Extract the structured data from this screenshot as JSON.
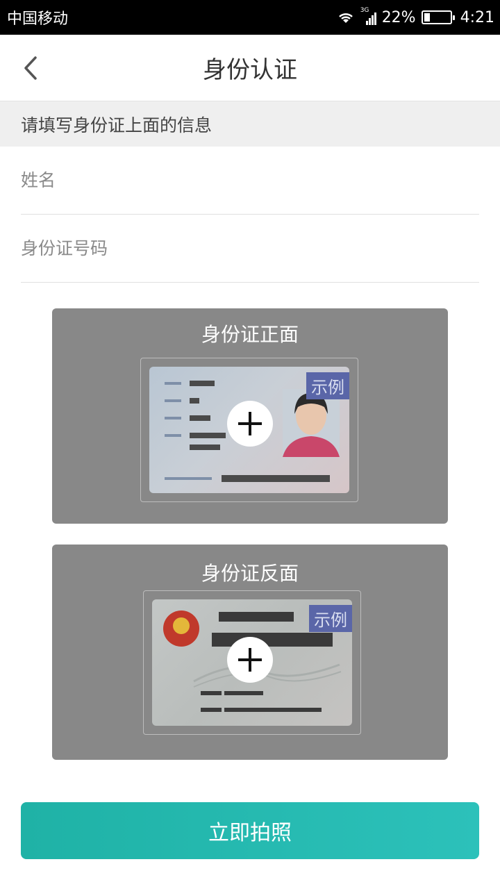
{
  "status_bar": {
    "carrier": "中国移动",
    "network": "3G",
    "battery_percent": "22%",
    "battery_level": 0.22,
    "time": "4:21",
    "icons": [
      "wifi-icon",
      "signal-icon",
      "battery-icon"
    ]
  },
  "nav": {
    "title": "身份认证",
    "back_icon": "chevron-left-icon"
  },
  "hint": "请填写身份证上面的信息",
  "form": {
    "name_placeholder": "姓名",
    "name_value": "",
    "id_placeholder": "身份证号码",
    "id_value": ""
  },
  "cards": {
    "front": {
      "title": "身份证正面",
      "sample_label": "示例",
      "plus_icon": "plus-icon"
    },
    "back": {
      "title": "身份证反面",
      "sample_label": "示例",
      "plus_icon": "plus-icon"
    }
  },
  "submit_label": "立即拍照",
  "colors": {
    "accent": "#26b8b0",
    "card_bg": "#888888",
    "sample_tag": "#5a66a8"
  }
}
